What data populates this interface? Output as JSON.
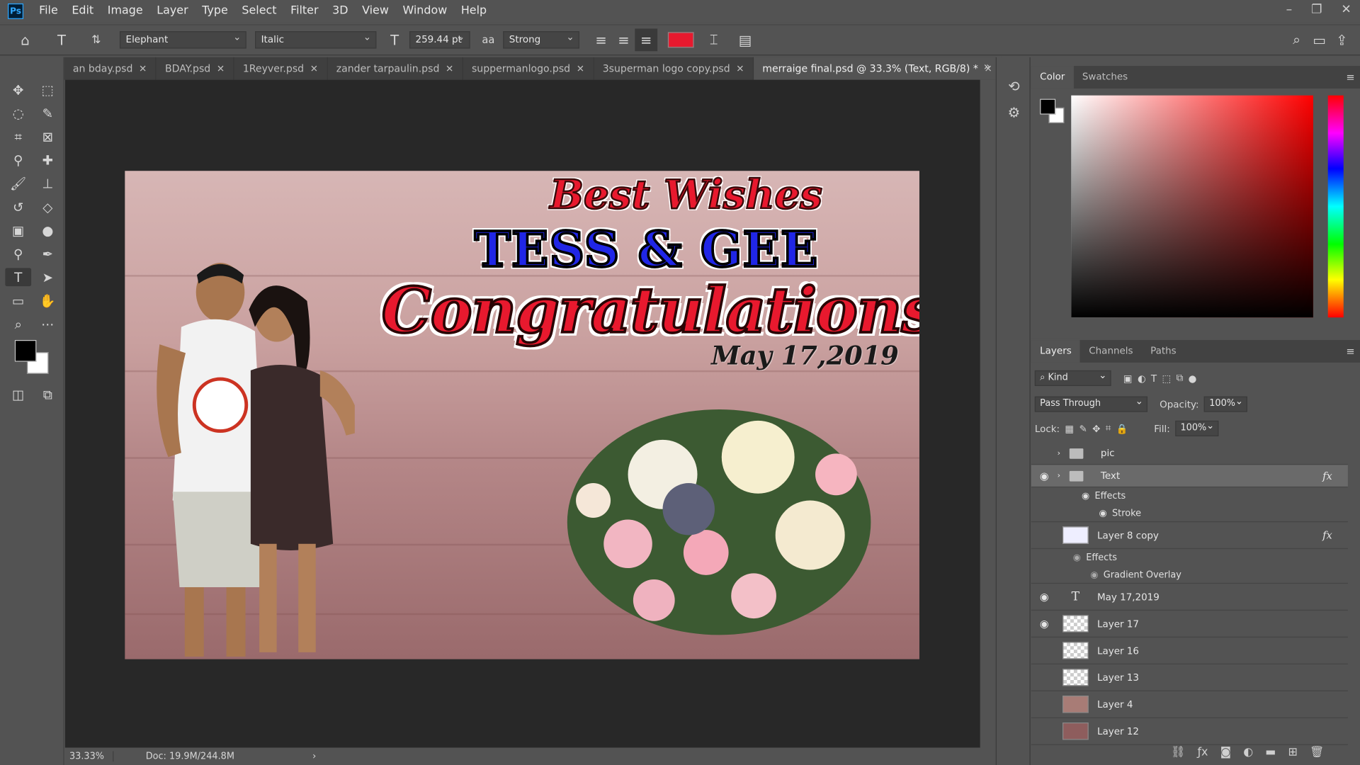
{
  "menu": [
    "File",
    "Edit",
    "Image",
    "Layer",
    "Type",
    "Select",
    "Filter",
    "3D",
    "View",
    "Window",
    "Help"
  ],
  "logo": "Ps",
  "window_controls": [
    "–",
    "❐",
    "✕"
  ],
  "options": {
    "font_family": "Elephant",
    "font_style": "Italic",
    "font_size": "259.44 pt",
    "aa_icon": "aa",
    "antialias": "Strong",
    "text_color": "#e8192e"
  },
  "tabs": [
    {
      "label": "an bday.psd"
    },
    {
      "label": "BDAY.psd"
    },
    {
      "label": "1Reyver.psd"
    },
    {
      "label": "zander tarpaulin.psd"
    },
    {
      "label": "suppermanlogo.psd"
    },
    {
      "label": "3superman logo copy.psd"
    },
    {
      "label": "merraige final.psd @ 33.3% (Text, RGB/8) *"
    }
  ],
  "canvas": {
    "best_wishes": "Best Wishes",
    "names": "TESS & GEE",
    "congrats": "Congratulations!",
    "date": "May 17,2019"
  },
  "status": {
    "zoom": "33.33%",
    "doc": "Doc: 19.9M/244.8M"
  },
  "color_panel": {
    "tabs": [
      "Color",
      "Swatches"
    ],
    "fg": "#000000",
    "bg": "#ffffff"
  },
  "layers_panel": {
    "tabs": [
      "Layers",
      "Channels",
      "Paths"
    ],
    "filter": "Kind",
    "blend": "Pass Through",
    "opacity_label": "Opacity:",
    "opacity": "100%",
    "lock_label": "Lock:",
    "fill_label": "Fill:",
    "fill": "100%",
    "rows": [
      {
        "name": "pic",
        "type": "group",
        "visible": false
      },
      {
        "name": "Text",
        "type": "group",
        "visible": true,
        "selected": true,
        "fx": "fx"
      },
      {
        "name": "Effects",
        "type": "effect"
      },
      {
        "name": "Stroke",
        "type": "effect-item"
      },
      {
        "name": "Layer 8 copy",
        "type": "layer",
        "visible": false,
        "fx": "fx"
      },
      {
        "name": "Effects",
        "type": "effect"
      },
      {
        "name": "Gradient Overlay",
        "type": "effect-item"
      },
      {
        "name": "May 17,2019",
        "type": "text",
        "visible": true
      },
      {
        "name": "Layer 17",
        "type": "layer",
        "visible": true
      },
      {
        "name": "Layer 16",
        "type": "layer",
        "visible": false
      },
      {
        "name": "Layer 13",
        "type": "layer",
        "visible": false
      },
      {
        "name": "Layer 4",
        "type": "layer",
        "visible": false
      },
      {
        "name": "Layer 12",
        "type": "layer",
        "visible": false
      }
    ]
  }
}
